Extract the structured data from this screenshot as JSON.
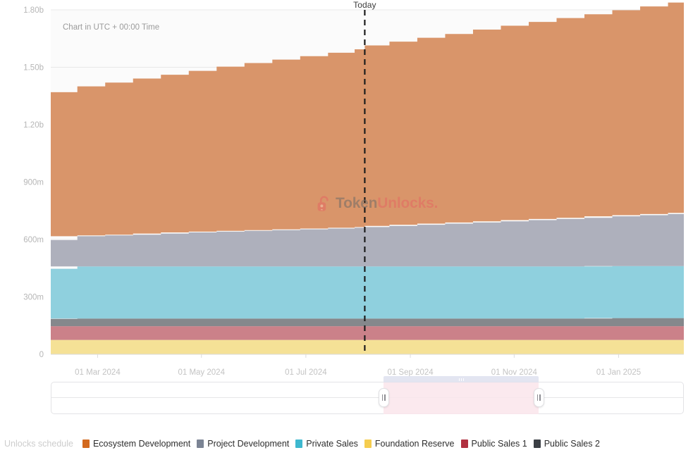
{
  "notes": {
    "utc": "Chart in UTC + 00:00 Time",
    "today": "Today"
  },
  "watermark": {
    "part1": "Token",
    "part2": "Unlocks.",
    "icon": "open-padlock-icon"
  },
  "legend": {
    "title": "Unlocks schedule",
    "items": [
      {
        "label": "Ecosystem Development",
        "color": "#d2691e"
      },
      {
        "label": "Project Development",
        "color": "#7b8494"
      },
      {
        "label": "Private Sales",
        "color": "#3eb8cf"
      },
      {
        "label": "Foundation Reserve",
        "color": "#f5cd4f"
      },
      {
        "label": "Public Sales 1",
        "color": "#b03040"
      },
      {
        "label": "Public Sales 2",
        "color": "#3b3f45"
      }
    ]
  },
  "range_slider": {
    "selection_start_label": "01 Sep 2024",
    "selection_end_label": "01 Nov 2024",
    "selection_start_pct": 52.5,
    "selection_end_pct": 77.0
  },
  "chart_data": {
    "type": "area",
    "title": "",
    "subtitle": "Chart in UTC + 00:00 Time",
    "xlabel": "",
    "ylabel": "",
    "stacked": true,
    "step": "post",
    "grid": true,
    "legend_position": "bottom",
    "ylim": [
      0,
      1800000000
    ],
    "ytick_values": [
      0,
      300000000,
      600000000,
      900000000,
      1200000000,
      1500000000,
      1800000000
    ],
    "ytick_labels": [
      "0",
      "300m",
      "600m",
      "900m",
      "1.20b",
      "1.50b",
      "1.80b"
    ],
    "xtick_labels": [
      "01 Mar 2024",
      "01 May 2024",
      "01 Jul 2024",
      "01 Sep 2024",
      "01 Nov 2024",
      "01 Jan 2025"
    ],
    "xtick_positions_pct": [
      7.4,
      23.8,
      40.3,
      56.8,
      73.2,
      89.7
    ],
    "today_marker": {
      "label": "Today",
      "position_pct": 49.6
    },
    "x": [
      0,
      4.2,
      8.6,
      13.0,
      17.4,
      21.8,
      26.2,
      30.6,
      35.0,
      39.4,
      43.8,
      48.0,
      49.6,
      53.5,
      57.9,
      62.3,
      66.7,
      71.1,
      75.5,
      79.9,
      84.3,
      88.7,
      93.1,
      97.5,
      100
    ],
    "series": [
      {
        "name": "Foundation Reserve",
        "color": "#f5e196",
        "values": [
          75,
          75,
          75,
          75,
          75,
          75,
          75,
          75,
          75,
          75,
          75,
          75,
          75,
          75,
          75,
          75,
          75,
          75,
          75,
          75,
          75,
          75,
          75,
          75,
          75
        ],
        "unit": "m"
      },
      {
        "name": "Public Sales 1",
        "color": "#cb8189",
        "values": [
          72,
          72,
          72,
          72,
          72,
          72,
          72,
          72,
          72,
          72,
          72,
          72,
          72,
          72,
          72,
          72,
          72,
          72,
          72,
          72,
          72,
          72,
          72,
          72,
          72
        ],
        "unit": "m"
      },
      {
        "name": "Public Sales 2",
        "color": "#85888c",
        "values": [
          38,
          40,
          40,
          40,
          40,
          40,
          40,
          40,
          40,
          40,
          40,
          40,
          40,
          40,
          40,
          40,
          40,
          40,
          40,
          40,
          40,
          42,
          42,
          42,
          42
        ],
        "unit": "m"
      },
      {
        "name": "Private Sales",
        "color": "#8fd0de",
        "values": [
          262,
          272,
          272,
          272,
          272,
          272,
          272,
          272,
          272,
          272,
          272,
          272,
          272,
          272,
          272,
          272,
          272,
          272,
          272,
          272,
          272,
          272,
          272,
          272,
          272
        ],
        "unit": "m"
      },
      {
        "name": "Project Development",
        "color": "#aeb0bc",
        "values": [
          150,
          158,
          162,
          166,
          172,
          178,
          182,
          186,
          190,
          194,
          198,
          202,
          206,
          212,
          218,
          224,
          230,
          236,
          242,
          248,
          254,
          260,
          266,
          272,
          278
        ],
        "unit": "m"
      },
      {
        "name": "Ecosystem Development",
        "color": "#d9956a",
        "values": [
          773,
          783,
          799,
          816,
          830,
          844,
          862,
          877,
          891,
          905,
          919,
          933,
          949,
          963,
          977,
          991,
          1008,
          1022,
          1036,
          1050,
          1064,
          1077,
          1091,
          1105,
          1112
        ],
        "unit": "m"
      }
    ],
    "totals": [
      1370,
      1400,
      1420,
      1441,
      1461,
      1481,
      1503,
      1522,
      1540,
      1558,
      1576,
      1594,
      1614,
      1634,
      1654,
      1674,
      1697,
      1717,
      1737,
      1757,
      1777,
      1798,
      1818,
      1838,
      1851
    ]
  }
}
